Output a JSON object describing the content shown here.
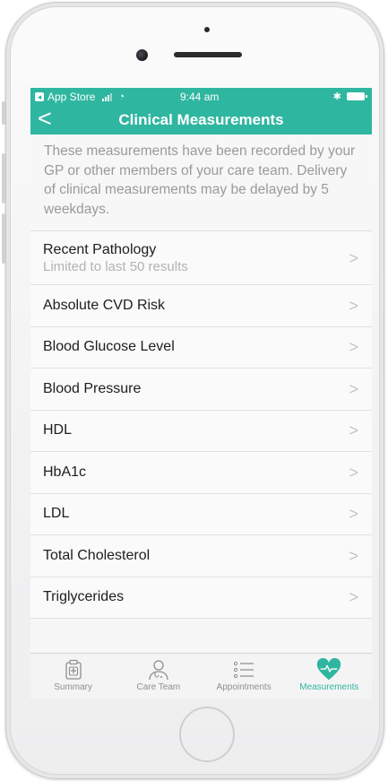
{
  "status_bar": {
    "back_app": "App Store",
    "time": "9:44 am"
  },
  "nav": {
    "back_glyph": "<",
    "title": "Clinical Measurements"
  },
  "intro_text": "These measurements have been recorded by your GP or other members of your care team. Delivery of clinical measurements may be delayed by 5 weekdays.",
  "rows": [
    {
      "label": "Recent Pathology",
      "sub": "Limited to last 50 results"
    },
    {
      "label": "Absolute CVD Risk"
    },
    {
      "label": "Blood Glucose Level"
    },
    {
      "label": "Blood Pressure"
    },
    {
      "label": "HDL"
    },
    {
      "label": "HbA1c"
    },
    {
      "label": "LDL"
    },
    {
      "label": "Total Cholesterol"
    },
    {
      "label": "Triglycerides"
    }
  ],
  "chevron": ">",
  "tabs": [
    {
      "label": "Summary",
      "icon": "clipboard-icon"
    },
    {
      "label": "Care Team",
      "icon": "doctor-icon"
    },
    {
      "label": "Appointments",
      "icon": "list-icon"
    },
    {
      "label": "Measurements",
      "icon": "heart-pulse-icon",
      "active": true
    }
  ],
  "colors": {
    "accent": "#2fb6a0",
    "tab_inactive": "#8e8e93"
  }
}
